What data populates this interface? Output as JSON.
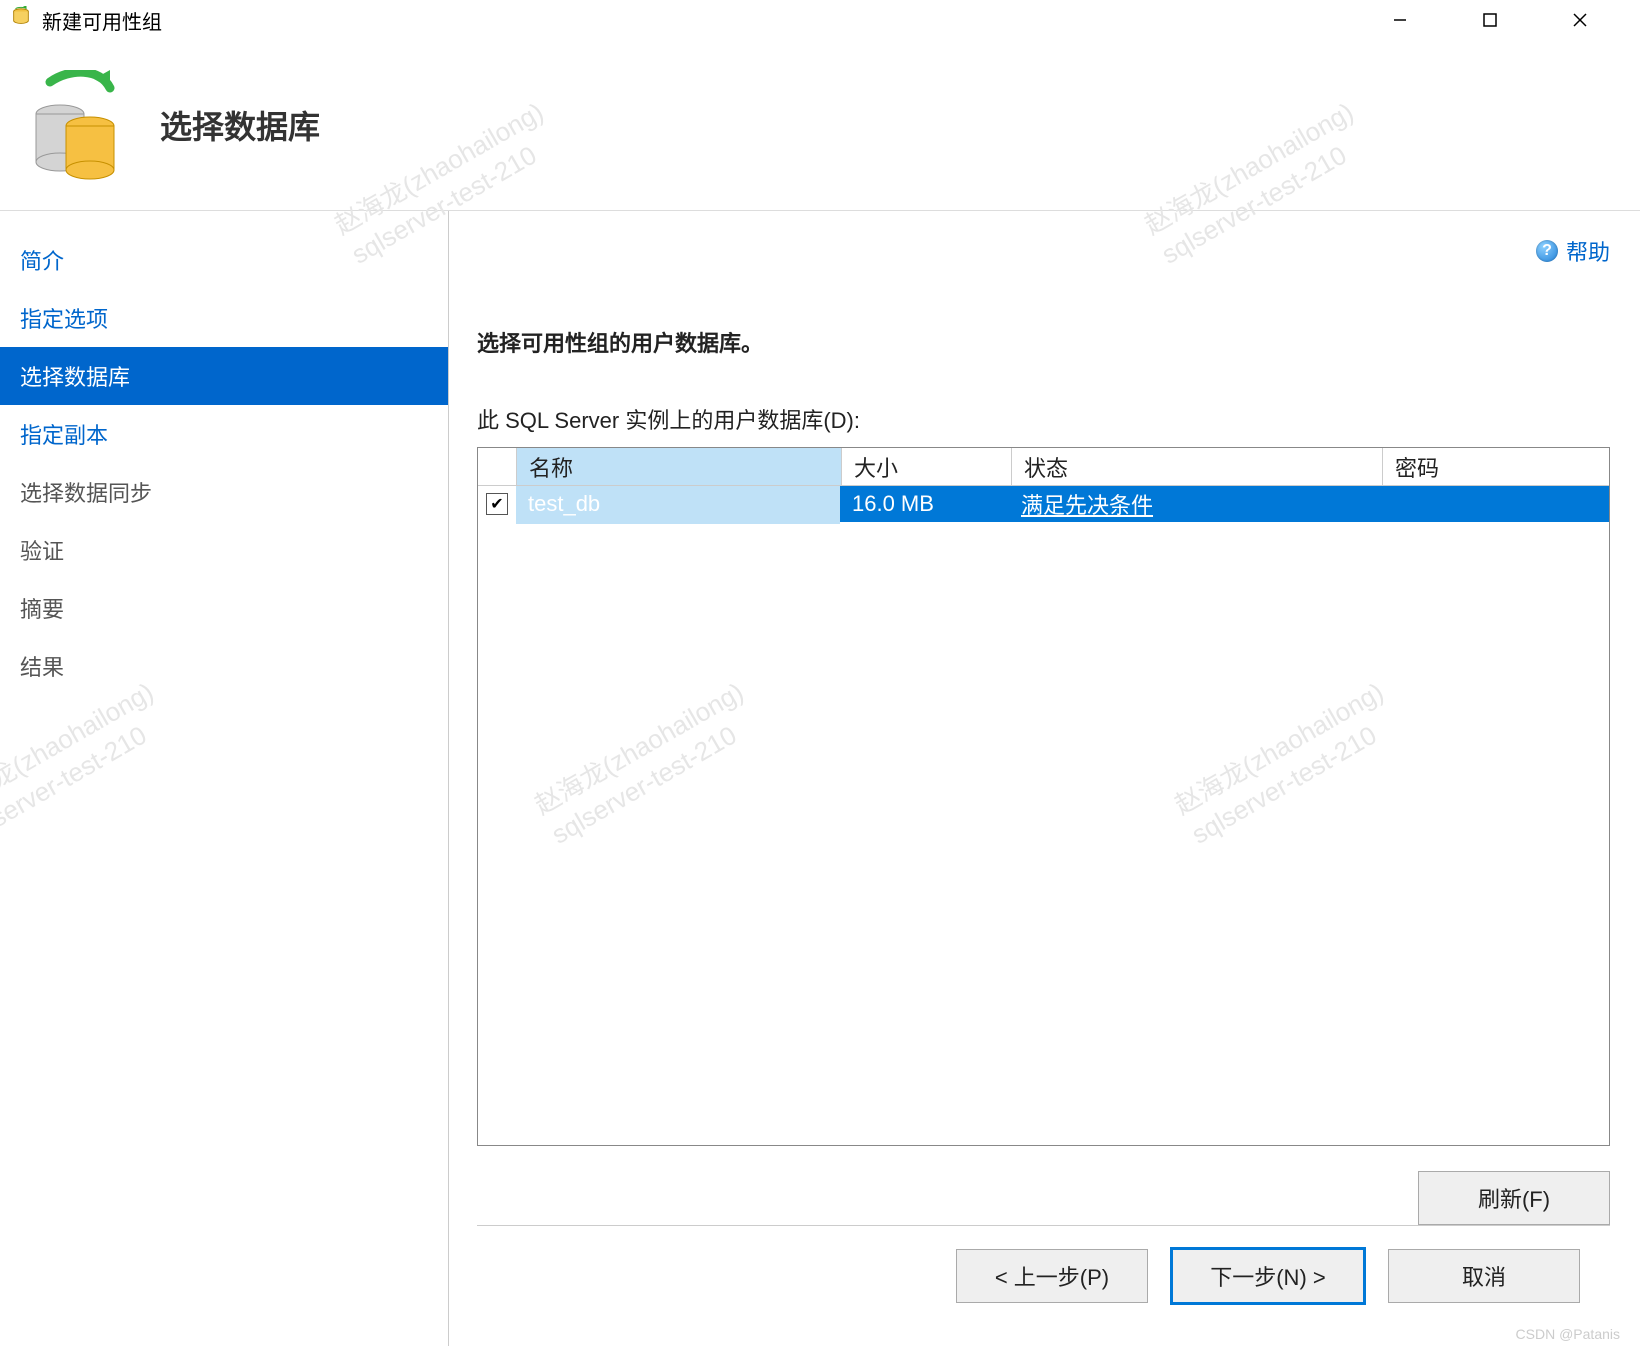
{
  "window": {
    "title": "新建可用性组"
  },
  "header": {
    "heading": "选择数据库"
  },
  "help": {
    "label": "帮助"
  },
  "sidebar": {
    "items": [
      {
        "label": "简介",
        "state": "link"
      },
      {
        "label": "指定选项",
        "state": "link"
      },
      {
        "label": "选择数据库",
        "state": "selected"
      },
      {
        "label": "指定副本",
        "state": "link"
      },
      {
        "label": "选择数据同步",
        "state": "disabled"
      },
      {
        "label": "验证",
        "state": "disabled"
      },
      {
        "label": "摘要",
        "state": "disabled"
      },
      {
        "label": "结果",
        "state": "disabled"
      }
    ]
  },
  "main": {
    "instruction": "选择可用性组的用户数据库。",
    "subtext": "此 SQL Server 实例上的用户数据库(D):",
    "columns": {
      "name": "名称",
      "size": "大小",
      "state": "状态",
      "password": "密码"
    },
    "rows": [
      {
        "checked": true,
        "name": "test_db",
        "size": "16.0 MB",
        "state": "满足先决条件",
        "password": ""
      }
    ],
    "refresh": "刷新(F)"
  },
  "footer": {
    "prev": "< 上一步(P)",
    "next": "下一步(N) >",
    "cancel": "取消"
  },
  "watermark": "CSDN @Patanis",
  "bg_watermark": "赵海龙(zhaohailong)\nsqlserver-test-210"
}
